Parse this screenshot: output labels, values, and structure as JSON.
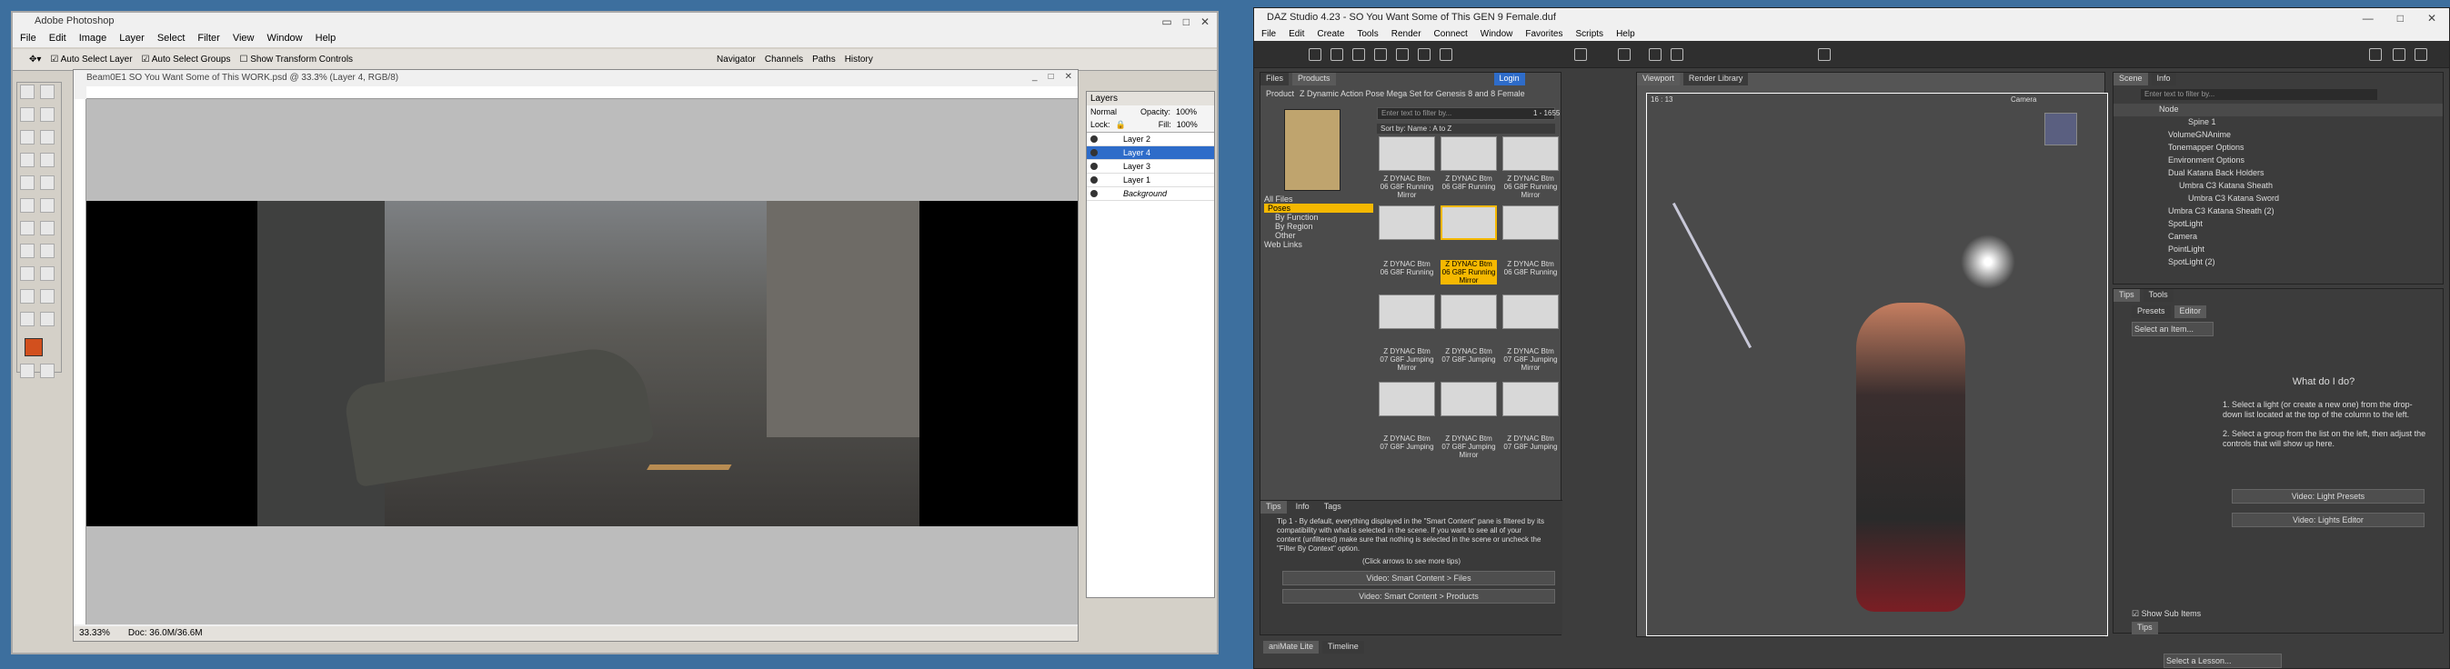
{
  "photoshop": {
    "window_title": "Adobe Photoshop",
    "menu": [
      "File",
      "Edit",
      "Image",
      "Layer",
      "Select",
      "Filter",
      "View",
      "Window",
      "Help"
    ],
    "options": {
      "auto_select_layer": "Auto Select Layer",
      "auto_select_groups": "Auto Select Groups",
      "show_transform": "Show Transform Controls"
    },
    "panel_tabs": [
      "Navigator",
      "Channels",
      "Paths",
      "History"
    ],
    "document_title": "Beam0E1 SO You Want Some of This WORK.psd @ 33.3% (Layer 4, RGB/8)",
    "status": {
      "zoom": "33.33%",
      "doc": "Doc: 36.0M/36.6M"
    },
    "layers_panel": {
      "title": "Layers",
      "blend_mode": "Normal",
      "opacity_label": "Opacity:",
      "opacity": "100%",
      "lock_label": "Lock:",
      "fill_label": "Fill:",
      "fill": "100%",
      "layers": [
        {
          "name": "Layer 2",
          "selected": false
        },
        {
          "name": "Layer 4",
          "selected": true
        },
        {
          "name": "Layer 3",
          "selected": false
        },
        {
          "name": "Layer 1",
          "selected": false
        },
        {
          "name": "Background",
          "selected": false
        }
      ]
    }
  },
  "daz": {
    "window_title": "DAZ Studio 4.23 - SO You Want Some of This GEN 9 Female.duf",
    "menu": [
      "File",
      "Edit",
      "Create",
      "Tools",
      "Render",
      "Connect",
      "Window",
      "Favorites",
      "Scripts",
      "Help"
    ],
    "content_tabs": [
      "Files",
      "Products"
    ],
    "login": "Login",
    "product_label": "Product",
    "product_name": "Z Dynamic Action Pose Mega Set for Genesis 8 and 8 Female",
    "filter_placeholder": "Enter text to filter by...",
    "count": "1 - 1655",
    "sort_label": "Sort by: Name : A to Z",
    "categories": {
      "all": "All Files",
      "poses": "Poses",
      "by_function": "By Function",
      "by_region": "By Region",
      "other": "Other",
      "web_links": "Web Links"
    },
    "thumbnails": [
      "Z DYNAC Btm 06 G8F Running Mirror",
      "Z DYNAC Btm 06 G8F Running",
      "Z DYNAC Btm 06 G8F Running Mirror",
      "Z DYNAC Btm 06 G8F Running",
      "Z DYNAC Btm 06 G8F Running Mirror",
      "Z DYNAC Btm 06 G8F Running",
      "Z DYNAC Btm 07 G8F Jumping Mirror",
      "Z DYNAC Btm 07 G8F Jumping",
      "Z DYNAC Btm 07 G8F Jumping Mirror",
      "Z DYNAC Btm 07 G8F Jumping",
      "Z DYNAC Btm 07 G8F Jumping Mirror",
      "Z DYNAC Btm 07 G8F Jumping"
    ],
    "tip_tabs": [
      "Tips",
      "Info",
      "Tags"
    ],
    "tip_text": "Tip 1 - By default, everything displayed in the \"Smart Content\" pane is filtered by its compatibility with what is selected in the scene. If you want to see all of your content (unfiltered) make sure that nothing is selected in the scene or uncheck the \"Filter By Context\" option.",
    "tip_more": "(Click arrows to see more tips)",
    "video_buttons": [
      "Video: Smart Content > Files",
      "Video: Smart Content > Products"
    ],
    "bottom_tabs": [
      "aniMate Lite",
      "Timeline"
    ],
    "viewport_tabs": [
      "Viewport",
      "Render Library"
    ],
    "camera": "Camera",
    "aspect": "16 : 13",
    "scene_tabs": [
      "Scene",
      "Info"
    ],
    "scene_search_placeholder": "Enter text to filter by...",
    "scene_header": "Node",
    "scene_nodes": [
      "Spine 1",
      "VolumeGNAnime",
      "Tonemapper Options",
      "Environment Options",
      "Dual Katana Back Holders",
      "Umbra C3 Katana Sheath",
      "Umbra C3 Katana Sword",
      "Umbra C3 Katana Sheath (2)",
      "SpotLight",
      "Camera",
      "PointLight",
      "SpotLight (2)"
    ],
    "lesson_tabs": [
      "Tips",
      "Tools"
    ],
    "lights_tabs": [
      "Presets",
      "Editor"
    ],
    "select_item": "Select an Item...",
    "what_do_title": "What do I do?",
    "steps": [
      "1. Select a light (or create a new one) from the drop-down list located at the top of the column to the left.",
      "2. Select a group from the list on the left, then adjust the controls that will show up here."
    ],
    "light_videos": [
      "Video: Light Presets",
      "Video: Lights Editor"
    ],
    "show_sub_items": "Show Sub Items",
    "tips_footer": "Tips",
    "lesson_select": "Select a Lesson..."
  }
}
